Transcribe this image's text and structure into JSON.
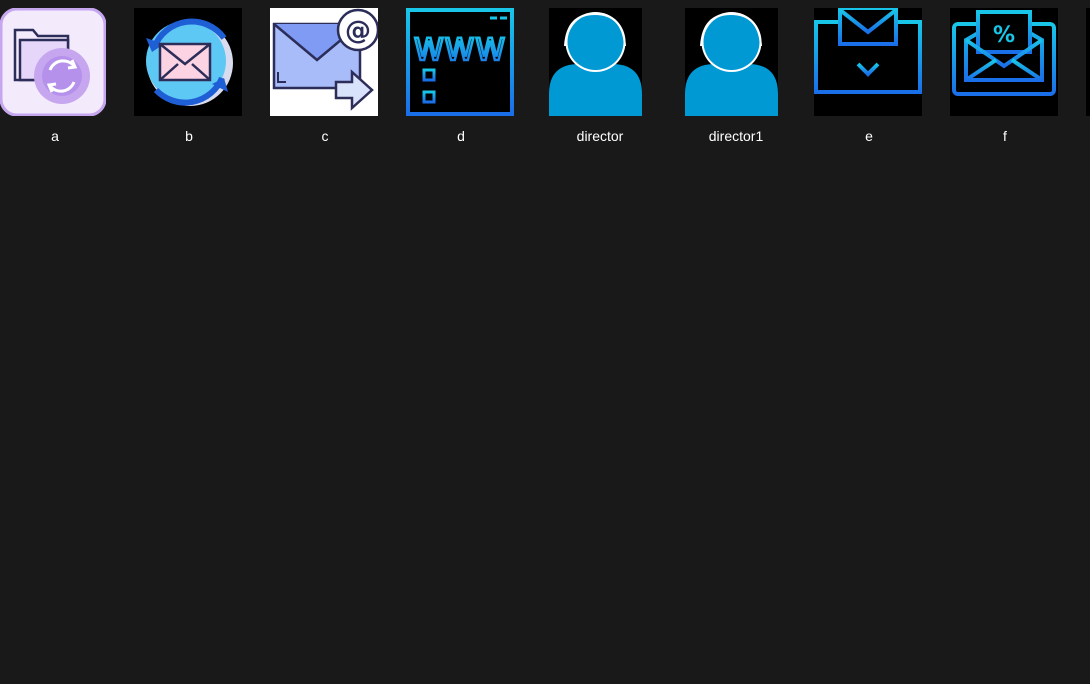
{
  "files": [
    {
      "id": "a",
      "label": "a",
      "icon": "folder-sync-icon"
    },
    {
      "id": "b",
      "label": "b",
      "icon": "mail-refresh-icon"
    },
    {
      "id": "c",
      "label": "c",
      "icon": "email-forward-icon"
    },
    {
      "id": "d",
      "label": "d",
      "icon": "web-page-icon"
    },
    {
      "id": "director",
      "label": "director",
      "icon": "user-avatar-icon"
    },
    {
      "id": "director1",
      "label": "director1",
      "icon": "user-avatar-icon"
    },
    {
      "id": "e",
      "label": "e",
      "icon": "monitor-mail-download-icon"
    },
    {
      "id": "f",
      "label": "f",
      "icon": "monitor-mail-discount-icon"
    }
  ],
  "colors": {
    "background": "#191919",
    "label": "#ffffff",
    "cyan": "#18c6e8",
    "blue": "#1a7be8",
    "avatar_blue": "#0099d4",
    "lavender": "#c6a7ef",
    "periwinkle": "#7f9bf4"
  }
}
